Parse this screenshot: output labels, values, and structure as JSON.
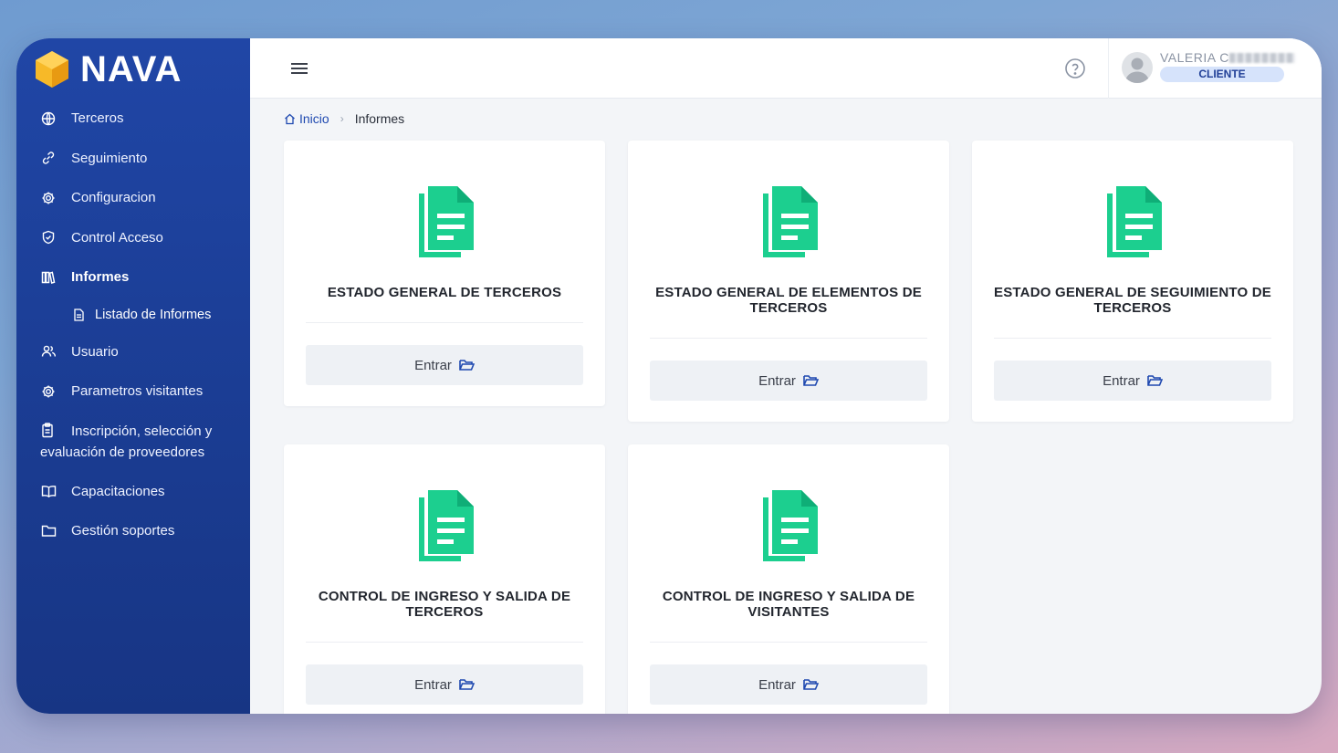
{
  "brand": {
    "name": "NAVA",
    "logo_icon": "hexagon-logo-icon",
    "logo_color": "#f7b928"
  },
  "sidebar": {
    "items": [
      {
        "label": "Terceros",
        "icon": "globe-icon"
      },
      {
        "label": "Seguimiento",
        "icon": "link-icon"
      },
      {
        "label": "Configuracion",
        "icon": "gear-icon"
      },
      {
        "label": "Control Acceso",
        "icon": "shield-icon"
      },
      {
        "label": "Informes",
        "icon": "book-stack-icon"
      },
      {
        "label": "Listado de Informes",
        "icon": "document-icon"
      },
      {
        "label": "Usuario",
        "icon": "users-icon"
      },
      {
        "label": "Parametros visitantes",
        "icon": "gear-icon"
      },
      {
        "label": "Inscripción, selección y evaluación de proveedores",
        "icon": "clipboard-icon"
      },
      {
        "label": "Capacitaciones",
        "icon": "open-book-icon"
      },
      {
        "label": "Gestión soportes",
        "icon": "folder-icon"
      }
    ]
  },
  "topbar": {
    "menu_icon": "hamburger-icon",
    "help_icon": "help-circle-icon",
    "user": {
      "name": "VALERIA C",
      "role": "CLIENTE"
    }
  },
  "breadcrumb": {
    "home": "Inicio",
    "current": "Informes"
  },
  "cards": [
    {
      "title": "ESTADO GENERAL DE TERCEROS",
      "button": "Entrar"
    },
    {
      "title": "ESTADO GENERAL DE ELEMENTOS DE TERCEROS",
      "button": "Entrar"
    },
    {
      "title": "ESTADO GENERAL DE SEGUIMIENTO DE TERCEROS",
      "button": "Entrar"
    },
    {
      "title": "CONTROL DE INGRESO Y SALIDA DE TERCEROS",
      "button": "Entrar"
    },
    {
      "title": "CONTROL DE INGRESO Y SALIDA DE VISITANTES",
      "button": "Entrar"
    }
  ],
  "colors": {
    "sidebar": "#1c3f98",
    "accent": "#1f49b0",
    "report_icon": "#1ccf8f",
    "badge_bg": "#d6e3fb"
  }
}
